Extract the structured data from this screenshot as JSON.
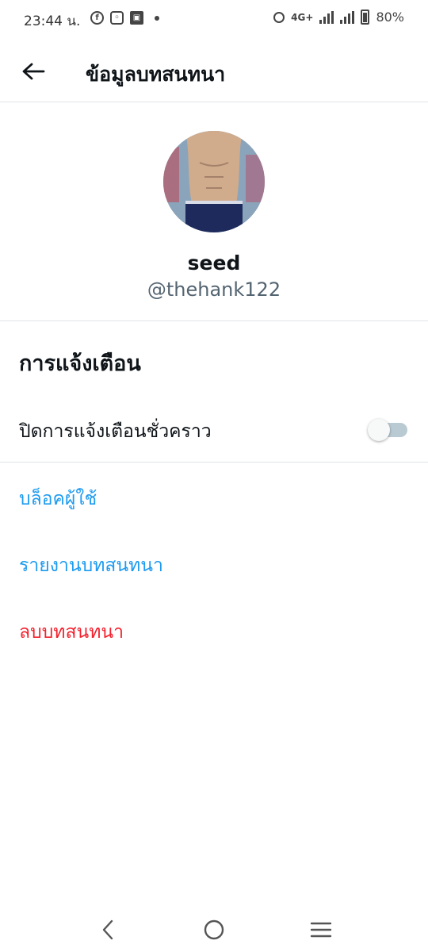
{
  "status_bar": {
    "time": "23:44 น.",
    "network": "4G+",
    "battery": "80%",
    "apps": [
      "facebook-icon",
      "instagram-icon",
      "facebook-page-icon"
    ]
  },
  "header": {
    "title": "ข้อมูลบทสนทนา",
    "back_icon": "arrow-left-icon"
  },
  "profile": {
    "name": "seed",
    "handle": "@thehank122"
  },
  "notifications": {
    "section_title": "การแจ้งเตือน",
    "snooze_label": "ปิดการแจ้งเตือนชั่วคราว",
    "snooze_on": false
  },
  "actions": {
    "block": "บล็อคผู้ใช้",
    "report": "รายงานบทสนทนา",
    "delete": "ลบบทสนทนา"
  },
  "colors": {
    "link_blue": "#1d9bf0",
    "danger_red": "#f4212e",
    "handle_gray": "#536471"
  }
}
